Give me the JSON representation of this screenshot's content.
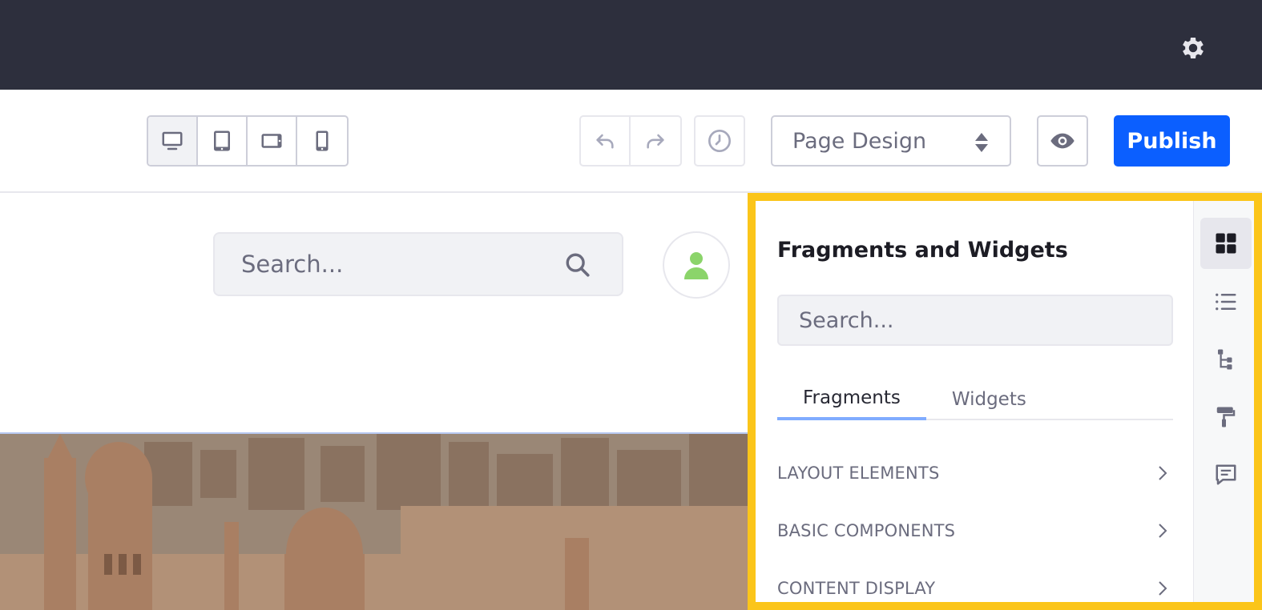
{
  "toolbar": {
    "page_design_label": "Page Design",
    "publish_label": "Publish"
  },
  "page": {
    "search_placeholder": "Search..."
  },
  "panel": {
    "title": "Fragments and Widgets",
    "search_placeholder": "Search...",
    "tabs": [
      {
        "label": "Fragments",
        "active": true
      },
      {
        "label": "Widgets",
        "active": false
      }
    ],
    "sections": [
      {
        "label": "LAYOUT ELEMENTS"
      },
      {
        "label": "BASIC COMPONENTS"
      },
      {
        "label": "CONTENT DISPLAY"
      }
    ]
  },
  "colors": {
    "topbar": "#2d2f3d",
    "primary": "#0b5fff",
    "highlight_border": "#fbc51a",
    "avatar_user": "#8bd46a"
  }
}
